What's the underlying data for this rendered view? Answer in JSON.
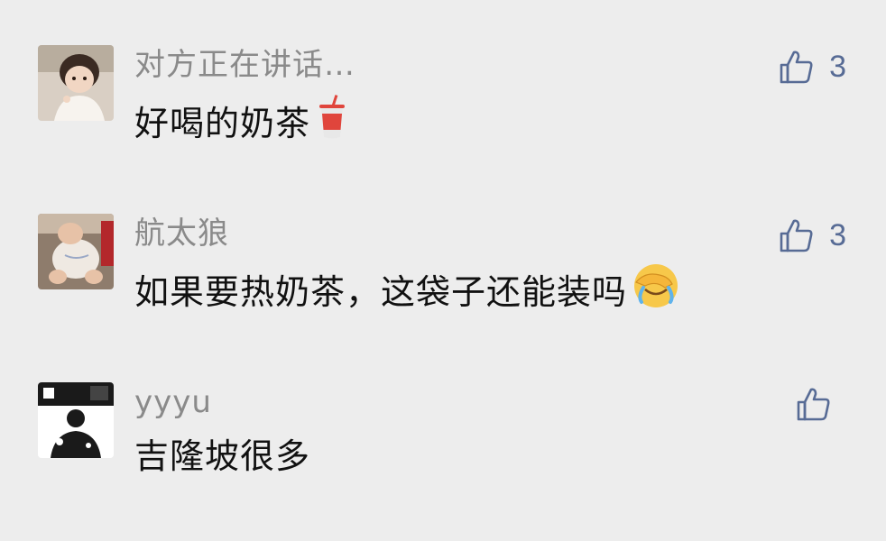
{
  "accent_color": "#576b95",
  "comments": [
    {
      "nickname": "对方正在讲话…",
      "content": "好喝的奶茶",
      "content_emoji": "cup-with-straw-emoji",
      "like_count": "3",
      "avatar": "avatar-girl-photo"
    },
    {
      "nickname": "航太狼",
      "content": "如果要热奶茶，这袋子还能装吗",
      "content_emoji": "face-palm-crying-emoji",
      "like_count": "3",
      "avatar": "avatar-baby-photo"
    },
    {
      "nickname": "yyyu",
      "content": "吉隆坡很多",
      "like_count": "",
      "avatar": "avatar-bw-photo"
    }
  ],
  "icons": {
    "like": "thumbs-up-icon"
  }
}
